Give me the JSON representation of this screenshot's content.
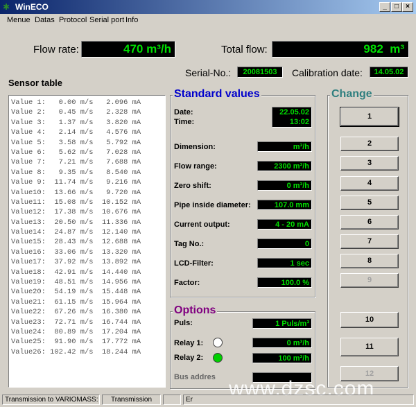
{
  "window": {
    "title": "WinECO",
    "icon": "wineco-app-icon"
  },
  "menu": [
    "Menue",
    "Datas",
    "Protocol",
    "Serial port",
    "Info"
  ],
  "flow_rate": {
    "label": "Flow rate:",
    "value": "470 m³/h"
  },
  "total_flow": {
    "label": "Total flow:",
    "value": "982  m³"
  },
  "serial": {
    "label": "Serial-No.:",
    "value": "20081503"
  },
  "calibration": {
    "label": "Calibration date:",
    "value": "14.05.02"
  },
  "sensor_table": {
    "title": "Sensor table",
    "rows": [
      "Value 1:   0.00 m/s   2.096 mA",
      "Value 2:   0.45 m/s   2.328 mA",
      "Value 3:   1.37 m/s   3.820 mA",
      "Value 4:   2.14 m/s   4.576 mA",
      "Value 5:   3.58 m/s   5.792 mA",
      "Value 6:   5.62 m/s   7.028 mA",
      "Value 7:   7.21 m/s   7.688 mA",
      "Value 8:   9.35 m/s   8.540 mA",
      "Value 9:  11.74 m/s   9.216 mA",
      "Value10:  13.66 m/s   9.720 mA",
      "Value11:  15.08 m/s  10.152 mA",
      "Value12:  17.38 m/s  10.676 mA",
      "Value13:  20.50 m/s  11.336 mA",
      "Value14:  24.87 m/s  12.140 mA",
      "Value15:  28.43 m/s  12.688 mA",
      "Value16:  33.06 m/s  13.320 mA",
      "Value17:  37.92 m/s  13.892 mA",
      "Value18:  42.91 m/s  14.440 mA",
      "Value19:  48.51 m/s  14.956 mA",
      "Value20:  54.19 m/s  15.448 mA",
      "Value21:  61.15 m/s  15.964 mA",
      "Value22:  67.26 m/s  16.380 mA",
      "Value23:  72.71 m/s  16.744 mA",
      "Value24:  80.89 m/s  17.204 mA",
      "Value25:  91.90 m/s  17.772 mA",
      "Value26: 102.42 m/s  18.244 mA"
    ]
  },
  "standard_values": {
    "title": "Standard values",
    "date_label": "Date:",
    "time_label": "Time:",
    "date_value": "22.05.02",
    "time_value": "13:02",
    "params": [
      {
        "label": "Dimension:",
        "value": "m³/h"
      },
      {
        "label": "Flow range:",
        "value": "2300 m³/h"
      },
      {
        "label": "Zero shift:",
        "value": "0 m³/h"
      },
      {
        "label": "Pipe inside diameter:",
        "value": "107.0 mm"
      },
      {
        "label": "Current output:",
        "value": "4 - 20 mA"
      },
      {
        "label": "Tag No.:",
        "value": "0"
      },
      {
        "label": "LCD-Filter:",
        "value": "1 sec"
      },
      {
        "label": "Factor:",
        "value": "100.0 %"
      }
    ]
  },
  "options": {
    "title": "Options",
    "puls_label": "Puls:",
    "puls_value": "1 Puls/m³",
    "relay1_label": "Relay 1:",
    "relay1_value": "0 m³/h",
    "relay2_label": "Relay 2:",
    "relay2_value": "100 m³/h",
    "bus_label": "Bus addres",
    "relay1_color": "#ffffff",
    "relay2_color": "#00d000"
  },
  "change": {
    "title": "Change",
    "buttons": [
      "1",
      "2",
      "3",
      "4",
      "5",
      "6",
      "7",
      "8",
      "9",
      "10",
      "11",
      "12"
    ]
  },
  "status": {
    "cell1": "Transmission to VARIOMASS:",
    "cell2": "Transmission",
    "cell3": "",
    "cell4": "Er"
  },
  "watermark": "www.dzsc.com",
  "colors": {
    "lcd_bg": "#000000",
    "lcd_fg": "#00e000",
    "standard_title": "#0000cc",
    "options_title": "#800080",
    "change_title": "#2f7f7f"
  }
}
